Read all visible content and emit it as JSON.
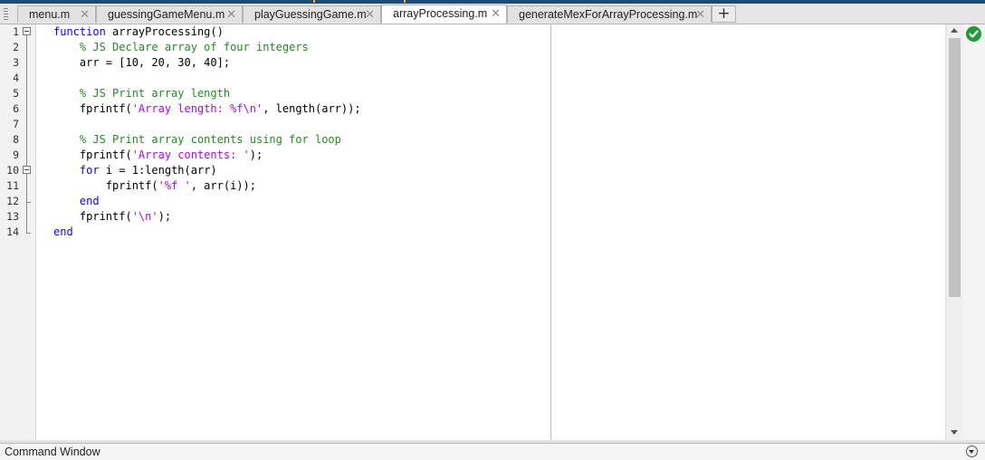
{
  "tabs": [
    {
      "label": "menu.m",
      "active": false
    },
    {
      "label": "guessingGameMenu.m",
      "active": false
    },
    {
      "label": "playGuessingGame.m",
      "active": false
    },
    {
      "label": "arrayProcessing.m",
      "active": true
    },
    {
      "label": "generateMexForArrayProcessing.m",
      "active": false
    }
  ],
  "tab_close_glyph": "✕",
  "add_tab_glyph": "+",
  "line_numbers": [
    "1",
    "2",
    "3",
    "4",
    "5",
    "6",
    "7",
    "8",
    "9",
    "10",
    "11",
    "12",
    "13",
    "14"
  ],
  "code_lines": [
    [
      {
        "t": "function",
        "c": "kw"
      },
      {
        "t": " arrayProcessing()",
        "c": ""
      }
    ],
    [
      {
        "t": "    % JS Declare array of four integers",
        "c": "cm"
      }
    ],
    [
      {
        "t": "    arr = [10, 20, 30, 40];",
        "c": ""
      }
    ],
    [],
    [
      {
        "t": "    % JS Print array length",
        "c": "cm"
      }
    ],
    [
      {
        "t": "    fprintf(",
        "c": ""
      },
      {
        "t": "'Array length: %f\\n'",
        "c": "st"
      },
      {
        "t": ", length(arr));",
        "c": ""
      }
    ],
    [],
    [
      {
        "t": "    % JS Print array contents using for loop",
        "c": "cm"
      }
    ],
    [
      {
        "t": "    fprintf(",
        "c": ""
      },
      {
        "t": "'Array contents: '",
        "c": "st"
      },
      {
        "t": ");",
        "c": ""
      }
    ],
    [
      {
        "t": "    ",
        "c": ""
      },
      {
        "t": "for",
        "c": "kw"
      },
      {
        "t": " i = 1:length(arr)",
        "c": ""
      }
    ],
    [
      {
        "t": "        fprintf(",
        "c": ""
      },
      {
        "t": "'%f '",
        "c": "st"
      },
      {
        "t": ", arr(i));",
        "c": ""
      }
    ],
    [
      {
        "t": "    ",
        "c": ""
      },
      {
        "t": "end",
        "c": "kw"
      }
    ],
    [
      {
        "t": "    fprintf(",
        "c": ""
      },
      {
        "t": "'\\n'",
        "c": "st"
      },
      {
        "t": ");",
        "c": ""
      }
    ],
    [
      {
        "t": "end",
        "c": "kw"
      }
    ]
  ],
  "colors": {
    "keyword": "#0e00ff",
    "comment": "#228b22",
    "string": "#a709f5",
    "analyzer_ok": "#1f9a3a"
  },
  "icons": {
    "analyzer": "check-circle-icon",
    "command_window_menu": "chevron-down-circle-icon"
  },
  "command_window": {
    "title": "Command Window"
  }
}
